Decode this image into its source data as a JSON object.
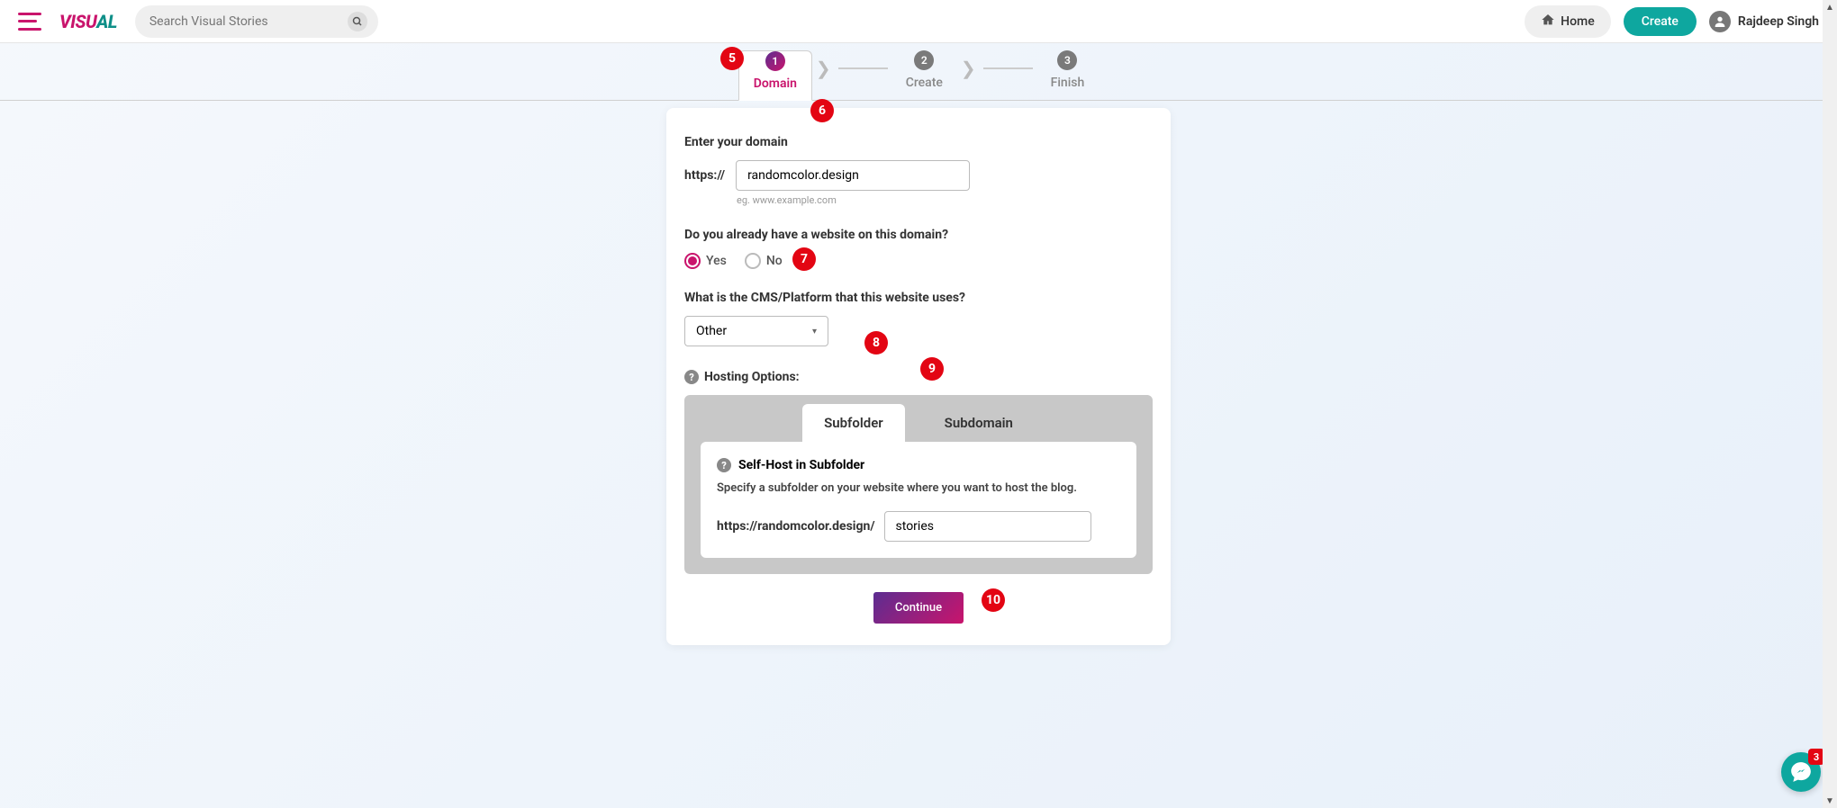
{
  "header": {
    "search_placeholder": "Search Visual Stories",
    "home_label": "Home",
    "create_label": "Create",
    "user_name": "Rajdeep Singh",
    "logo_primary": "VISU",
    "logo_secondary": "AL"
  },
  "steps": {
    "step1": {
      "num": "1",
      "label": "Domain"
    },
    "step2": {
      "num": "2",
      "label": "Create"
    },
    "step3": {
      "num": "3",
      "label": "Finish"
    }
  },
  "domain": {
    "section_title": "Enter your domain",
    "prefix": "https://",
    "value": "randomcolor.design",
    "hint": "eg. www.example.com"
  },
  "existing": {
    "question": "Do you already have a website on this domain?",
    "yes_label": "Yes",
    "no_label": "No"
  },
  "cms": {
    "question": "What is the CMS/Platform that this website uses?",
    "selected": "Other"
  },
  "hosting": {
    "title": "Hosting Options:",
    "tab_subfolder": "Subfolder",
    "tab_subdomain": "Subdomain",
    "selfhost_title": "Self-Host in Subfolder",
    "selfhost_desc": "Specify a subfolder on your website where you want to host the blog.",
    "subfolder_prefix": "https://randomcolor.design/",
    "subfolder_value": "stories"
  },
  "actions": {
    "continue_label": "Continue"
  },
  "annotations": {
    "a5": "5",
    "a6": "6",
    "a7": "7",
    "a8": "8",
    "a9": "9",
    "a10": "10"
  },
  "chat": {
    "badge": "3"
  }
}
